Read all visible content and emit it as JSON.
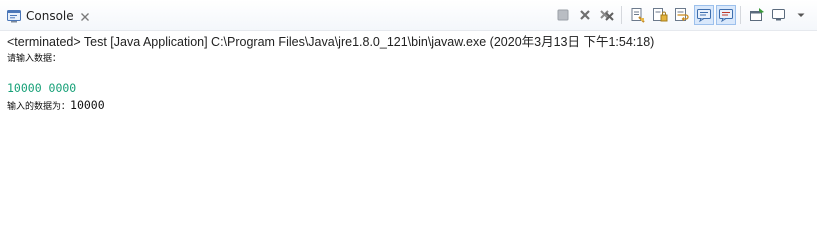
{
  "tab": {
    "title": "Console",
    "icon": "console-icon",
    "close_icon": "close-icon"
  },
  "status": "<terminated> Test [Java Application] C:\\Program Files\\Java\\jre1.8.0_121\\bin\\javaw.exe (2020年3月13日 下午1:54:18)",
  "console": {
    "prompt": "请输入数据：",
    "user_input": "10000 0000",
    "output_label": "输入的数据为：",
    "output_value": "10000"
  },
  "toolbar": {
    "icons": [
      "terminate-icon",
      "remove-launch-icon",
      "remove-all-terminated-icon",
      "clear-console-icon",
      "scroll-lock-icon",
      "word-wrap-icon",
      "show-on-stdout-icon",
      "show-on-stderr-icon",
      "pin-console-icon",
      "display-selected-console-icon",
      "view-menu-icon"
    ]
  },
  "colors": {
    "input_text": "#16a077",
    "tab_bar_bg": "#f4f7fb"
  }
}
